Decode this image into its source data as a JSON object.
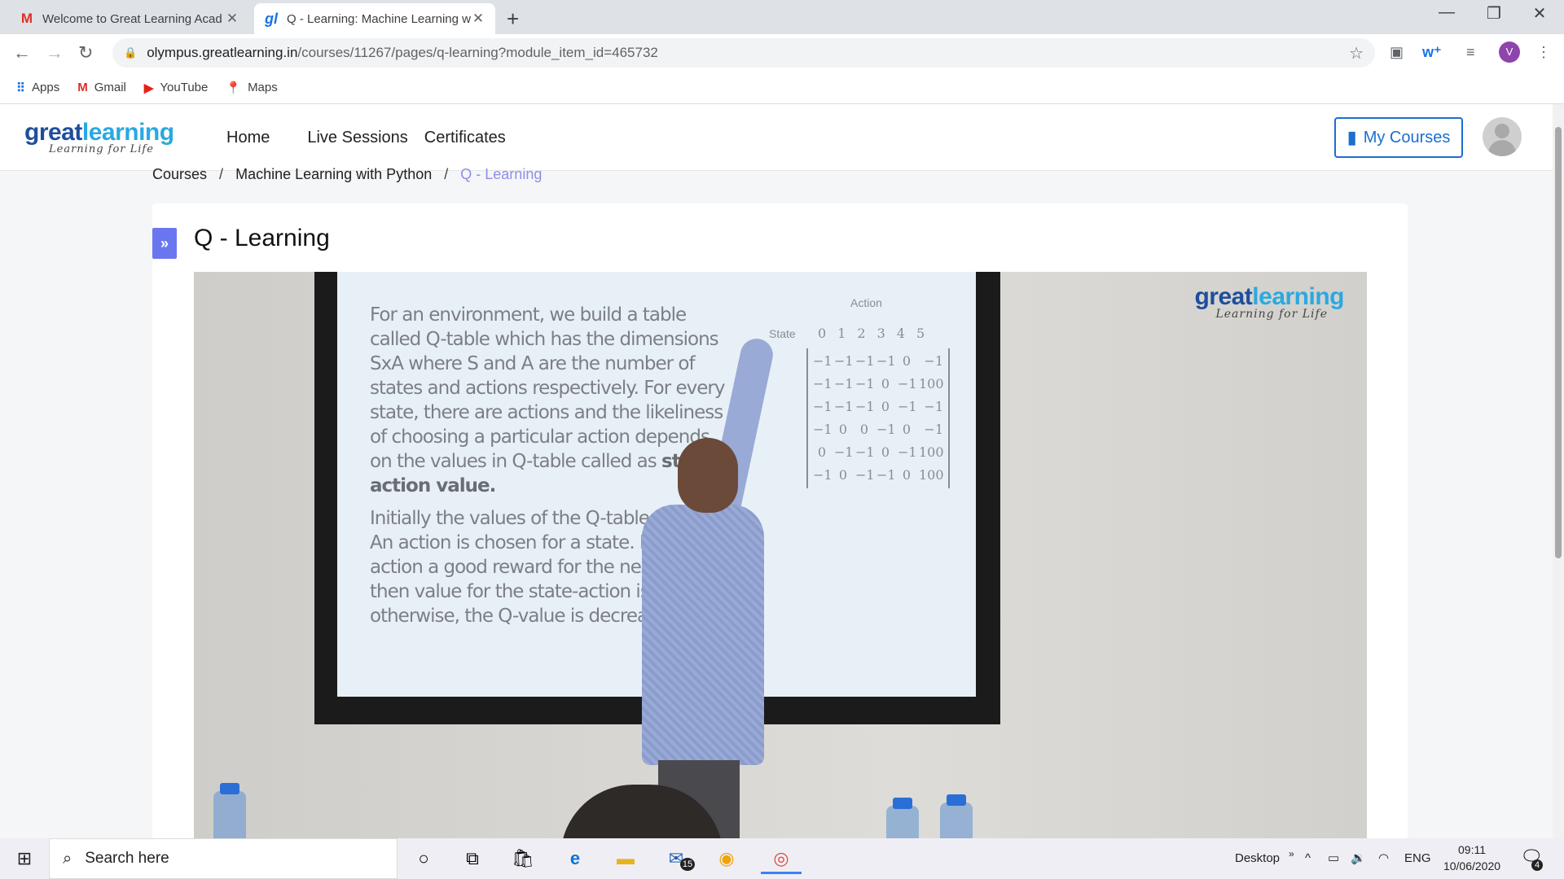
{
  "browser": {
    "tabs": [
      {
        "title": "Welcome to Great Learning Acad",
        "icon": "gmail-icon"
      },
      {
        "title": "Q - Learning: Machine Learning w",
        "icon": "greatlearning-icon"
      }
    ],
    "new_tab": "+",
    "url_host": "olympus.greatlearning.in",
    "url_path": "/courses/11267/pages/q-learning?module_item_id=465732",
    "profile_initial": "V",
    "bookmarks": [
      {
        "label": "Apps",
        "icon": "apps-grid-icon"
      },
      {
        "label": "Gmail",
        "icon": "gmail-icon"
      },
      {
        "label": "YouTube",
        "icon": "youtube-icon"
      },
      {
        "label": "Maps",
        "icon": "maps-pin-icon"
      }
    ]
  },
  "site": {
    "logo_main_1": "great",
    "logo_main_2": "learning",
    "logo_tagline": "Learning for Life",
    "nav": {
      "home": "Home",
      "live_sessions": "Live Sessions",
      "certificates": "Certificates"
    },
    "my_courses": "My Courses"
  },
  "breadcrumb": {
    "courses": "Courses",
    "course": "Machine Learning with Python",
    "current": "Q - Learning",
    "sep": "/"
  },
  "page": {
    "expander_icon": "»",
    "title": "Q - Learning"
  },
  "video": {
    "slide_para1": "For an environment, we build a table called Q-table which has the dimensions SxA where S and A are the number of states and actions respectively. For every state, there are actions and the likeliness of choosing a particular action depends on the values in Q-table called as",
    "slide_para1_bold": "state-action value.",
    "slide_para2": "Initially the values of the Q-table are 0. An action is chosen for a state. If that action a good reward for the next state then value for the state-action is increase otherwise, the Q-value is decrease",
    "matrix": {
      "action_label": "Action",
      "state_label": "State",
      "columns": [
        "0",
        "1",
        "2",
        "3",
        "4",
        "5"
      ],
      "rows": [
        [
          "−1",
          "−1",
          "−1",
          "−1",
          "0",
          "−1"
        ],
        [
          "−1",
          "−1",
          "−1",
          "0",
          "−1",
          "100"
        ],
        [
          "−1",
          "−1",
          "−1",
          "0",
          "−1",
          "−1"
        ],
        [
          "−1",
          "0",
          "0",
          "−1",
          "0",
          "−1"
        ],
        [
          "0",
          "−1",
          "−1",
          "0",
          "−1",
          "100"
        ],
        [
          "−1",
          "0",
          "−1",
          "−1",
          "0",
          "100"
        ]
      ]
    },
    "watermark_1": "great",
    "watermark_2": "learning",
    "watermark_tagline": "Learning for Life"
  },
  "taskbar": {
    "search_placeholder": "Search here",
    "desktop_label": "Desktop",
    "language": "ENG",
    "time": "09:11",
    "date": "10/06/2020",
    "mail_badge": "15",
    "notification_badge": "4"
  },
  "colors": {
    "brand_blue": "#1f4e9c",
    "brand_light_blue": "#2aa9e0",
    "my_courses_blue": "#1a6fd0",
    "breadcrumb_current": "#8f8fe8",
    "expander": "#6a76f0"
  }
}
